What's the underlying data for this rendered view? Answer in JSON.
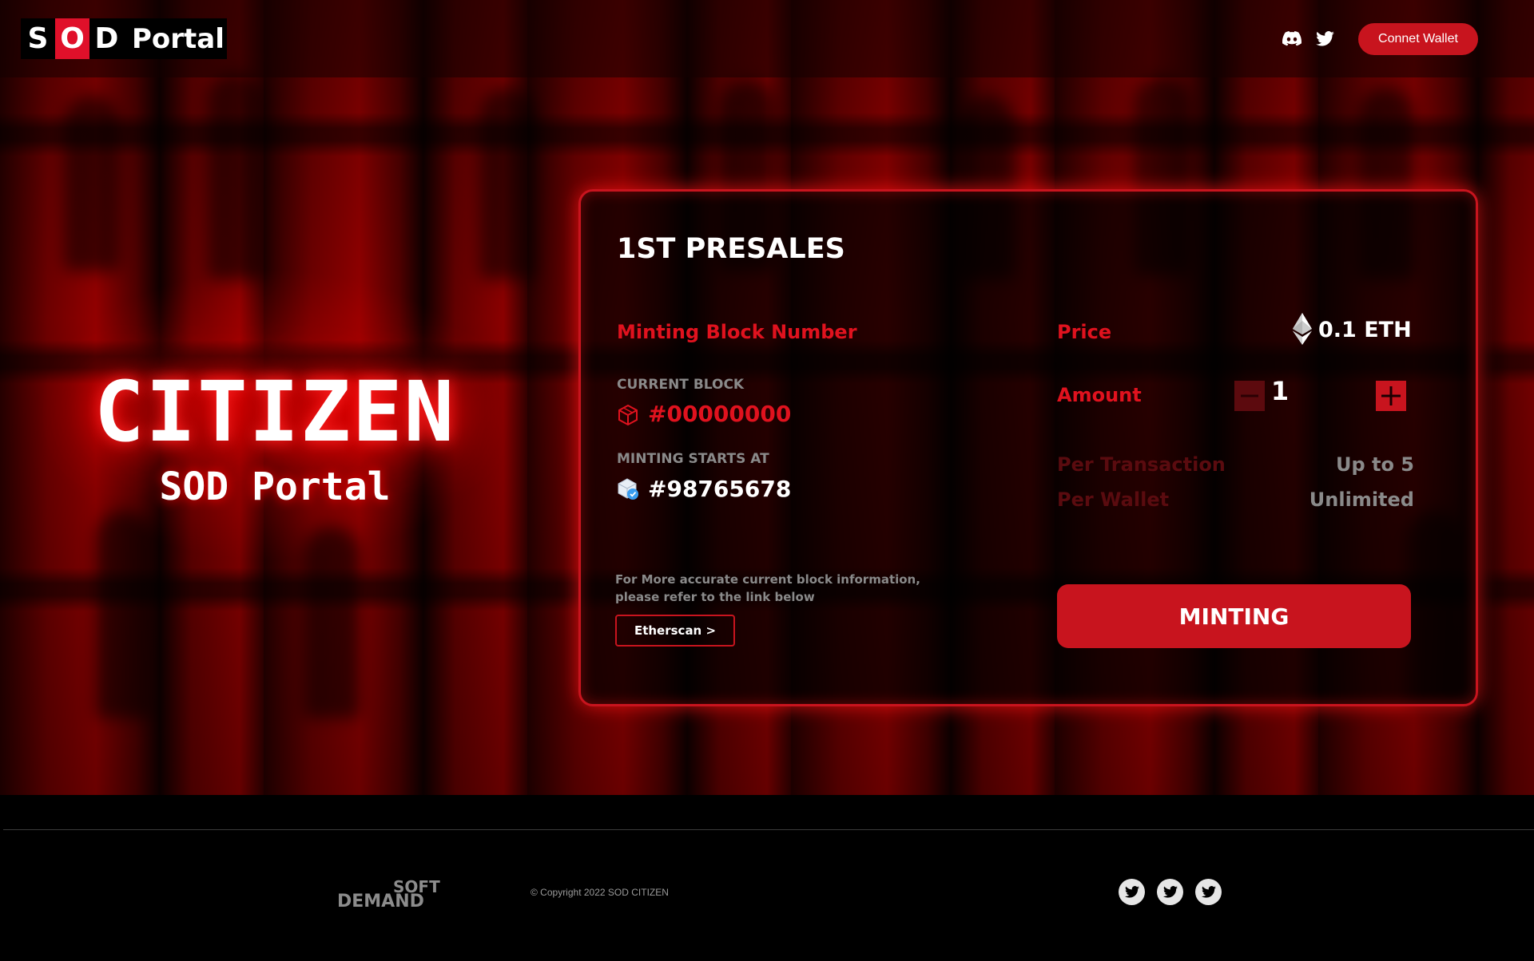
{
  "header": {
    "logo": {
      "letters": [
        "S",
        "O",
        "D"
      ],
      "portal": "Portal"
    },
    "connect_wallet": "Connet Wallet",
    "icons": [
      "discord-icon",
      "twitter-icon"
    ]
  },
  "hero": {
    "title": "CITIZEN",
    "subtitle": "SOD Portal"
  },
  "panel": {
    "title": "1ST PRESALES",
    "minting_block_label": "Minting Block Number",
    "current_block_label": "CURRENT BLOCK",
    "current_block_value": "#00000000",
    "minting_starts_label": "MINTING STARTS AT",
    "minting_starts_value": "#98765678",
    "price_label": "Price",
    "price_value": "0.1 ETH",
    "amount_label": "Amount",
    "amount_value": "1",
    "per_transaction_label": "Per Transaction",
    "per_transaction_value": "Up to 5",
    "per_wallet_label": "Per Wallet",
    "per_wallet_value": "Unlimited",
    "note": "For More accurate current block information, please refer to the link below",
    "etherscan_label": "Etherscan >",
    "mint_label": "MINTING"
  },
  "footer": {
    "brand_top": "SOFT",
    "brand_bottom": "DEMAND",
    "copyright": "© Copyright 2022 SOD CITIZEN",
    "social_icons": [
      "twitter-icon",
      "twitter-icon",
      "twitter-icon"
    ]
  },
  "colors": {
    "accent": "#c8141e",
    "accent_bright": "#e0121e",
    "dim_red": "#5a0b0f",
    "grey_text": "#8a8a8a"
  }
}
